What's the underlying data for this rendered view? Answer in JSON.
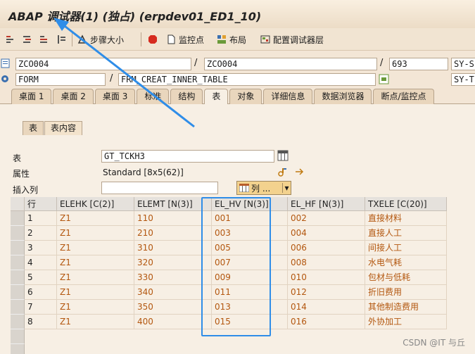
{
  "window": {
    "title": "ABAP 调试器(1) (独占) (erpdev01_ED1_10)"
  },
  "toolbar": {
    "step_size_label": "步骤大小",
    "watchpoint_label": "监控点",
    "layout_label": "布局",
    "config_layer_label": "配置调试器层"
  },
  "fields": {
    "program_1": "ZCO004",
    "program_2": "ZCO004",
    "line_no": "693",
    "sy_1": "SY-S",
    "event_type": "FORM",
    "event_name": "FRM_CREAT_INNER_TABLE",
    "sy_2": "SY-T"
  },
  "tabs": [
    {
      "label": "桌面 1"
    },
    {
      "label": "桌面 2"
    },
    {
      "label": "桌面 3"
    },
    {
      "label": "标准"
    },
    {
      "label": "结构"
    },
    {
      "label": "表"
    },
    {
      "label": "对象"
    },
    {
      "label": "详细信息"
    },
    {
      "label": "数据浏览器"
    },
    {
      "label": "断点/监控点"
    }
  ],
  "subtabs": [
    {
      "label": "表"
    },
    {
      "label": "表内容"
    }
  ],
  "table_info": {
    "table_label": "表",
    "table_value": "GT_TCKH3",
    "attr_label": "属性",
    "attr_value": "Standard [8x5(62)]",
    "insert_col_label": "插入列",
    "insert_col_value": "",
    "columns_button": "列 ..."
  },
  "grid": {
    "headers": [
      "行",
      "ELEHK [C(2)]",
      "ELEMT [N(3)]",
      "EL_HV [N(3)]",
      "EL_HF [N(3)]",
      "TXELE [C(20)]"
    ],
    "rows": [
      [
        "1",
        "Z1",
        "110",
        "001",
        "002",
        "直接材料"
      ],
      [
        "2",
        "Z1",
        "210",
        "003",
        "004",
        "直接人工"
      ],
      [
        "3",
        "Z1",
        "310",
        "005",
        "006",
        "间接人工"
      ],
      [
        "4",
        "Z1",
        "320",
        "007",
        "008",
        "水电气耗"
      ],
      [
        "5",
        "Z1",
        "330",
        "009",
        "010",
        "包材与低耗"
      ],
      [
        "6",
        "Z1",
        "340",
        "011",
        "012",
        "折旧费用"
      ],
      [
        "7",
        "Z1",
        "350",
        "013",
        "014",
        "其他制造费用"
      ],
      [
        "8",
        "Z1",
        "400",
        "015",
        "016",
        "外协加工"
      ]
    ]
  },
  "watermark": "CSDN @IT 与丘",
  "colors": {
    "highlight": "#2f8de8",
    "cell_text": "#b3570f"
  }
}
